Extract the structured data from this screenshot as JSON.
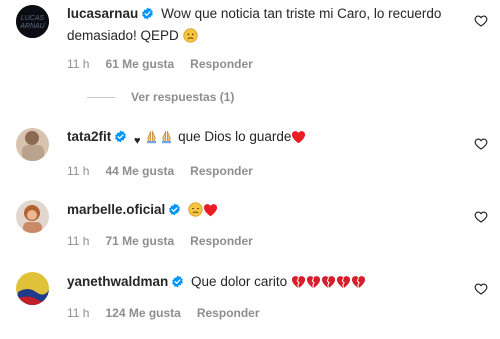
{
  "comments": [
    {
      "username": "lucasarnau",
      "text": "Wow que noticia tan triste mi Caro, lo recuerdo demasiado! QEPD",
      "time": "11 h",
      "likes": "61 Me gusta",
      "reply": "Responder",
      "view_replies": "Ver respuestas (1)"
    },
    {
      "username": "tata2fit",
      "text": "que Dios lo guarde",
      "time": "11 h",
      "likes": "44 Me gusta",
      "reply": "Responder"
    },
    {
      "username": "marbelle.oficial",
      "text": "",
      "time": "11 h",
      "likes": "71 Me gusta",
      "reply": "Responder"
    },
    {
      "username": "yanethwaldman",
      "text": "Que dolor carito",
      "time": "11 h",
      "likes": "124 Me gusta",
      "reply": "Responder"
    }
  ],
  "colors": {
    "verified": "#0095f6",
    "heart_red": "#ed4956",
    "meta_gray": "#8e8e8e"
  }
}
